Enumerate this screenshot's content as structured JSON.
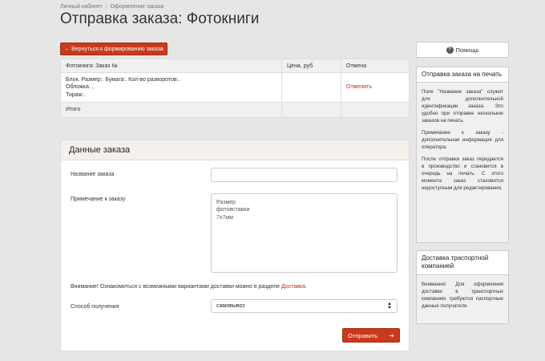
{
  "breadcrumb": [
    "Личный кабинет",
    "Оформление заказа"
  ],
  "page_title": "Отправка заказа: Фотокниги",
  "back_button": "← Вернуться к формированию заказа",
  "table": {
    "headers": [
      "Фотокнига: Заказ №",
      "Цена, руб",
      "Отмена"
    ],
    "item_lines": [
      "Блок. Размер:. Бумага:. Кол-во разворотов:.",
      "Обложка. ,",
      "Тираж:."
    ],
    "item_price": "",
    "cancel_link": "Отменить",
    "total_label": "Итого",
    "total_value": ""
  },
  "form": {
    "title": "Данные заказа",
    "order_name_label": "Название заказа",
    "order_name_value": "",
    "note_label": "Примечание к заказу",
    "note_value": "Размер\nфотовставки\n7х7мм",
    "notice_text": "Внимание! Ознакомиться с возможными вариантами доставки можно в разделе ",
    "notice_link": "Доставка",
    "notice_end": ".",
    "delivery_label": "Способ получения",
    "delivery_value": "самовывоз",
    "submit_label": "Отправить"
  },
  "help_button": "Помощь",
  "sidebar": {
    "card1": {
      "title": "Отправка заказа на печать",
      "paragraphs": [
        "Поле \"Название заказа\" служит для дополнительной идентификации заказа. Это удобно при отправке нескольких заказов на печать.",
        "Примечание к заказу - дополнительная информация для оператора.",
        "После отправки заказ передается в производство и становится в очередь на печать. С этого момента заказ становится недоступным для редактирования."
      ]
    },
    "card2": {
      "title": "Доставка траспортной компанией",
      "paragraphs": [
        "Внимание! Для оформления доставки в транспортных компаниях требуются паспортные данные получателя."
      ]
    }
  }
}
